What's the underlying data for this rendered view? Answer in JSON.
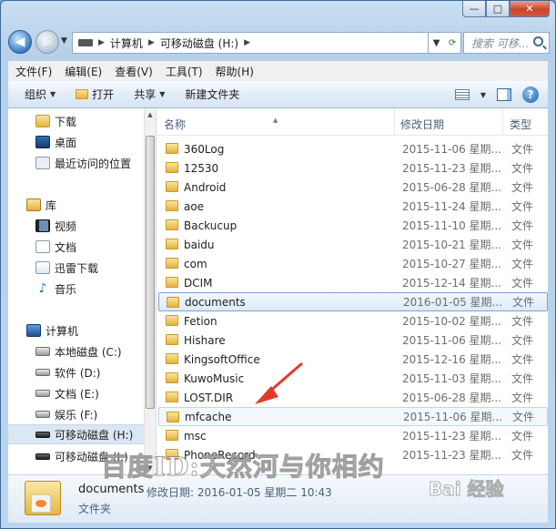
{
  "window": {
    "caption_buttons": {
      "minimize": "—",
      "maximize": "□",
      "close": "✕"
    }
  },
  "nav": {
    "back_icon": "back-arrow-icon",
    "forward_icon": "forward-arrow-icon",
    "breadcrumb": [
      "计算机",
      "可移动磁盘 (H:)"
    ],
    "search_placeholder": "搜索 可移..."
  },
  "menu": [
    "文件(F)",
    "编辑(E)",
    "查看(V)",
    "工具(T)",
    "帮助(H)"
  ],
  "commands": {
    "organize": "组织",
    "open": "打开",
    "share": "共享",
    "new_folder": "新建文件夹"
  },
  "sidebar": {
    "items": [
      {
        "label": "下载",
        "icon": "downloads-folder-icon"
      },
      {
        "label": "桌面",
        "icon": "desktop-icon"
      },
      {
        "label": "最近访问的位置",
        "icon": "recent-places-icon"
      },
      {
        "label": "库",
        "icon": "libraries-icon"
      },
      {
        "label": "视频",
        "icon": "videos-icon"
      },
      {
        "label": "文档",
        "icon": "documents-icon"
      },
      {
        "label": "迅雷下载",
        "icon": "thunder-download-icon"
      },
      {
        "label": "音乐",
        "icon": "music-icon"
      },
      {
        "label": "计算机",
        "icon": "computer-icon"
      },
      {
        "label": "本地磁盘 (C:)",
        "icon": "system-drive-icon"
      },
      {
        "label": "软件 (D:)",
        "icon": "drive-icon"
      },
      {
        "label": "文档 (E:)",
        "icon": "drive-icon"
      },
      {
        "label": "娱乐 (F:)",
        "icon": "drive-icon"
      },
      {
        "label": "可移动磁盘 (H:)",
        "icon": "usb-drive-icon"
      },
      {
        "label": "可移动磁盘 (I:)",
        "icon": "usb-drive-icon"
      }
    ]
  },
  "list": {
    "columns": {
      "name": "名称",
      "date": "修改日期",
      "type": "类型"
    },
    "rows": [
      {
        "name": "360Log",
        "date": "2015-11-06 星期...",
        "type": "文件"
      },
      {
        "name": "12530",
        "date": "2015-11-23 星期...",
        "type": "文件"
      },
      {
        "name": "Android",
        "date": "2015-06-28 星期...",
        "type": "文件"
      },
      {
        "name": "aoe",
        "date": "2015-11-24 星期...",
        "type": "文件"
      },
      {
        "name": "Backucup",
        "date": "2015-11-10 星期...",
        "type": "文件"
      },
      {
        "name": "baidu",
        "date": "2015-10-21 星期...",
        "type": "文件"
      },
      {
        "name": "com",
        "date": "2015-10-27 星期...",
        "type": "文件"
      },
      {
        "name": "DCIM",
        "date": "2015-12-14 星期...",
        "type": "文件"
      },
      {
        "name": "documents",
        "date": "2016-01-05 星期...",
        "type": "文件"
      },
      {
        "name": "Fetion",
        "date": "2015-10-02 星期...",
        "type": "文件"
      },
      {
        "name": "Hishare",
        "date": "2015-11-06 星期...",
        "type": "文件"
      },
      {
        "name": "KingsoftOffice",
        "date": "2015-12-16 星期...",
        "type": "文件"
      },
      {
        "name": "KuwoMusic",
        "date": "2015-11-03 星期...",
        "type": "文件"
      },
      {
        "name": "LOST.DIR",
        "date": "2015-06-28 星期...",
        "type": "文件"
      },
      {
        "name": "mfcache",
        "date": "2015-11-06 星期...",
        "type": "文件"
      },
      {
        "name": "msc",
        "date": "2015-11-23 星期...",
        "type": "文件"
      },
      {
        "name": "PhoneRecord",
        "date": "2015-11-23 星期...",
        "type": "文件"
      }
    ]
  },
  "details": {
    "name": "documents",
    "modified": "修改日期: 2016-01-05 星期二 10:43",
    "type": "文件夹"
  },
  "watermark": {
    "text": "百度ID:天然河与你相约",
    "logo": "Bai 经验"
  }
}
